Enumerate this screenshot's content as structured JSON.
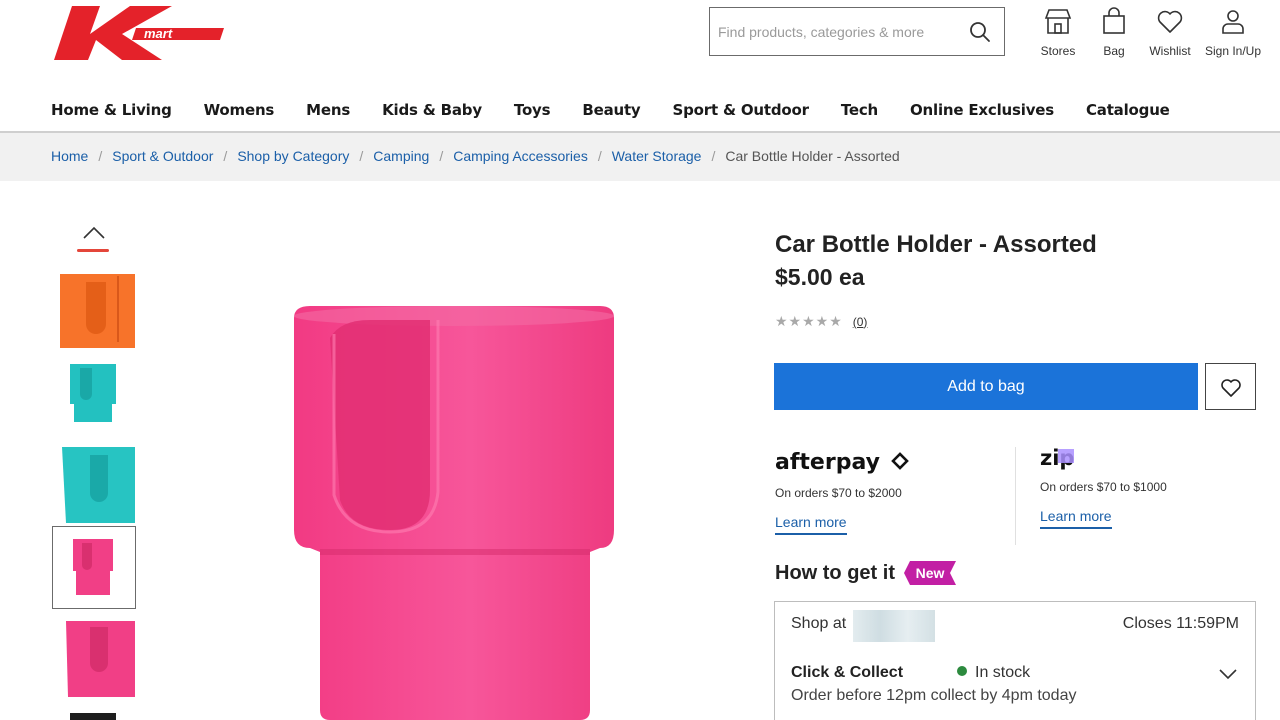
{
  "header": {
    "logo_text": "mart",
    "search_placeholder": "Find products, categories & more",
    "actions": [
      {
        "label": "Stores",
        "icon": "store-icon"
      },
      {
        "label": "Bag",
        "icon": "bag-icon"
      },
      {
        "label": "Wishlist",
        "icon": "heart-icon"
      },
      {
        "label": "Sign In/Up",
        "icon": "user-icon"
      }
    ]
  },
  "nav": {
    "items": [
      "Home & Living",
      "Womens",
      "Mens",
      "Kids & Baby",
      "Toys",
      "Beauty",
      "Sport & Outdoor",
      "Tech",
      "Online Exclusives",
      "Catalogue"
    ]
  },
  "breadcrumb": {
    "items": [
      "Home",
      "Sport & Outdoor",
      "Shop by Category",
      "Camping",
      "Camping Accessories",
      "Water Storage"
    ],
    "current": "Car Bottle Holder - Assorted"
  },
  "gallery": {
    "thumbnails": [
      {
        "color": "#f7732a",
        "name": "orange"
      },
      {
        "color": "#23c1c0",
        "name": "teal-small"
      },
      {
        "color": "#27c4c2",
        "name": "teal-large"
      },
      {
        "color": "#f13f86",
        "name": "pink-selected"
      },
      {
        "color": "#f13f86",
        "name": "pink"
      },
      {
        "color": "#1e1e1e",
        "name": "black"
      }
    ],
    "selected_index": 3,
    "main_color": "#f53d86"
  },
  "product": {
    "title": "Car Bottle Holder - Assorted",
    "price": "$5.00 ea",
    "rating_stars": "★★★★★",
    "rating_count": "(0)",
    "add_to_bag": "Add to bag"
  },
  "payments": {
    "afterpay": {
      "logo": "afterpay",
      "text": "On orders $70 to $2000",
      "link": "Learn more"
    },
    "zip": {
      "logo": "zip",
      "text": "On orders $70 to $1000",
      "link": "Learn more"
    }
  },
  "fulfilment": {
    "heading": "How to get it",
    "badge": "New",
    "shop_at": "Shop at",
    "closes": "Closes 11:59PM",
    "method": "Click & Collect",
    "stock": "In stock",
    "note": "Order before 12pm collect by 4pm today"
  },
  "colors": {
    "accent_blue": "#1b73d9",
    "brand_red": "#e4222a",
    "link_blue": "#1b5fa8",
    "badge_magenta": "#c21fa4",
    "in_stock_green": "#2c8a3e"
  }
}
